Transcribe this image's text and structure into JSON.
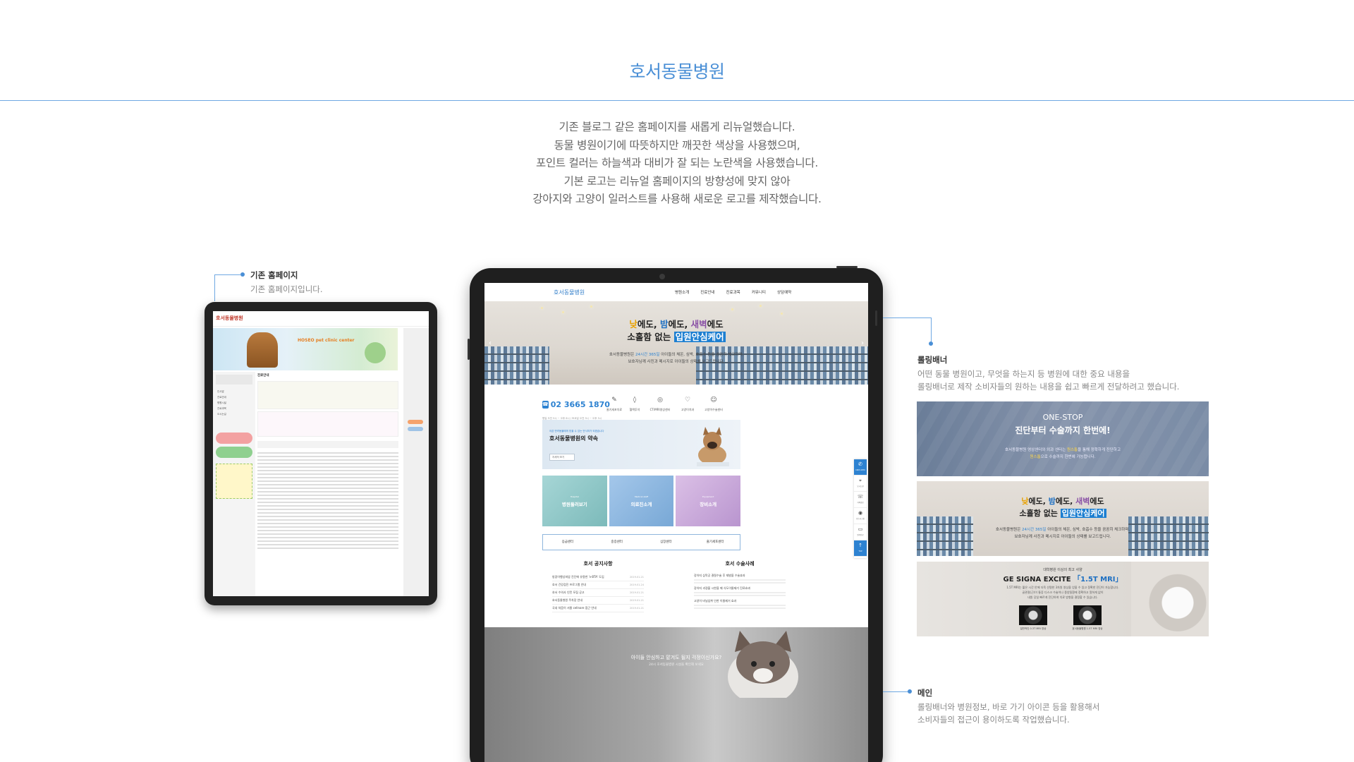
{
  "page": {
    "title": "호서동물병원",
    "intro": [
      "기존 블로그 같은 홈페이지를 새롭게 리뉴얼했습니다.",
      "동물 병원이기에 따뜻하지만 깨끗한 색상을 사용했으며,",
      "포인트 컬러는 하늘색과 대비가 잘 되는 노란색을 사용했습니다.",
      "기본 로고는 리뉴얼 홈페이지의 방향성에 맞지 않아",
      "강아지와 고양이 일러스트를 사용해 새로운 로고를 제작했습니다."
    ]
  },
  "captions": {
    "old": {
      "title": "기존 홈페이지",
      "desc": "기존 홈페이지입니다."
    },
    "rolling": {
      "title": "롤링배너",
      "desc": [
        "어떤 동물 병원이고, 무엇을 하는지 등 병원에 대한 중요 내용을",
        "롤링배너로 제작 소비자들의 원하는 내용을 쉽고 빠르게 전달하려고 했습니다."
      ]
    },
    "main": {
      "title": "메인",
      "desc": [
        "롤링배너와 병원정보, 바로 가기 아이콘 등을 활용해서",
        "소비자들의 접근이 용이하도록 작업했습니다."
      ]
    }
  },
  "old_site": {
    "logo": "호서동물병원",
    "banner_title": "HOSEO pet clinic center",
    "section_title": "진료안내",
    "menu": [
      "인사말",
      "진료안내",
      "병원시설",
      "진료과목",
      "오시는길"
    ]
  },
  "main_site": {
    "logo": "호서동물병원",
    "menu": [
      "병원소개",
      "진료안내",
      "진료과목",
      "커뮤니티",
      "상담예약"
    ],
    "hero": {
      "line1_parts": [
        "낮",
        "에도, ",
        "밤",
        "에도, ",
        "새벽",
        "에도"
      ],
      "line2_pre": "소홀함 없는 ",
      "line2_box": "입원안심케어",
      "sub1_pre": "호서동물병원은 ",
      "sub1_hl": "24시간 365일",
      "sub1_post": " 아이들의 체온, 심박, 호흡수 등을 꼼꼼히 체크하며,",
      "sub2": "보호자님께 사진과 메시지로 아이들의 상태를 보고드립니다."
    },
    "phone": "02 3665 1870",
    "phone_sub": "평일 오전 9시 ~ 오후 8시 / 토요일 오전 9시 ~ 오후 5시",
    "quick": [
      {
        "icon": "syringe-icon",
        "glyph": "✎",
        "label": "줄기세포치료"
      },
      {
        "icon": "drop-icon",
        "glyph": "◊",
        "label": "혈액투석"
      },
      {
        "icon": "ct-icon",
        "glyph": "◎",
        "label": "CT/MRI영상센터"
      },
      {
        "icon": "tooth-icon",
        "glyph": "♡",
        "label": "고양이치과"
      },
      {
        "icon": "cat-icon",
        "glyph": "☺",
        "label": "고양이수술센터"
      }
    ],
    "promise": {
      "small": "아픈 반려동물에게 믿을 수 있는 안식처가 되겠습니다",
      "title": "호서동물병원의 약속",
      "button": "자세히 보기"
    },
    "cards": [
      {
        "small": "Hospital",
        "label": "병원둘러보기",
        "color": "#8fcfcf"
      },
      {
        "small": "Medical staff",
        "label": "의료진소개",
        "color": "#8cb7e0"
      },
      {
        "small": "Equipment",
        "label": "장비소개",
        "color": "#c9a8d8"
      }
    ],
    "centers": [
      "응급센터",
      "중증센터",
      "심장센터",
      "줄기세포센터"
    ],
    "notice": {
      "title": "호서 공지사항",
      "rows": [
        {
          "t": "방광이행상피암 진단에 유용한 'v-BTA' 도입",
          "d": "2019.01.21"
        },
        {
          "t": "호서 건강검진 프로그램 안내",
          "d": "2019.01.24"
        },
        {
          "t": "호서 수의사 인턴 모집 공고",
          "d": "2019.01.21"
        },
        {
          "t": "호서동물병원 주차장 안내",
          "d": "2019.01.21"
        },
        {
          "t": "국내 처음이 서울 cellnare 접근 안내",
          "d": "2019.01.21"
        }
      ]
    },
    "cases": {
      "title": "호서 수술사례",
      "rows": [
        "강아지 심막공 결절수술 후 재발을 수술효과",
        "강아지 괴경불 시한을 때 식도이물제거 진료효과",
        "고양이 비닐섭취 인한 이물제거 효과"
      ]
    },
    "cat_banner": {
      "line1": "아이들 안심하고 맡겨도 될지 걱정이신가요?",
      "line2": "24시 호서동물병원 시설을 확인해 보세요"
    },
    "floating": [
      {
        "icon": "phone-icon",
        "glyph": "✆",
        "label": "1663-1870"
      },
      {
        "icon": "map-pin-icon",
        "glyph": "⌖",
        "label": "오시는길"
      },
      {
        "icon": "chat-icon",
        "glyph": "☏",
        "label": "카톡상담"
      },
      {
        "icon": "instagram-icon",
        "glyph": "◉",
        "label": "인스타그램"
      },
      {
        "icon": "monitor-icon",
        "glyph": "▭",
        "label": "원격진료"
      },
      {
        "icon": "top-icon",
        "glyph": "↑",
        "label": "TOP"
      }
    ]
  },
  "banners": {
    "one_stop": {
      "title": "ONE-STOP",
      "sub": "진단부터 수술까지 한번에!",
      "desc1": "호서동물병원 영상센터와 외과 센터는 ",
      "desc1_hl": "원스톱",
      "desc1_post": "을 통해 정확하게 진단하고",
      "desc2_hl": "원스톱",
      "desc2_post": "으로 수술까지 한번에 가능합니다."
    },
    "care": {
      "line1_parts": [
        "낮",
        "에도, ",
        "밤",
        "에도, ",
        "새벽",
        "에도"
      ],
      "line2_pre": "소홀함 없는 ",
      "line2_box": "입원안심케어",
      "sub1_pre": "호서동물병원은 ",
      "sub1_hl": "24시간 365일",
      "sub1_post": " 아이들의 체온, 심박, 호흡수 등을 꼼꼼히 체크하며,",
      "sub2": "보호자님께 사진과 메시지로 아이들의 상태를 보고드립니다."
    },
    "mri": {
      "small": "대학병원 이상의 최고 사양",
      "title_pre": "GE SIGNA EXCITE ",
      "title_hl": "「1.5T MRI」",
      "desc1": "1.5T MRI는 짧은 시간 안에 더욱 선명한 3차원 영상을 얻을 수 있고 정확한 진단이 가능합니다.",
      "desc2": "골관절(근)이 통증 디스크 수술이나 종양질환에 정확하고 알하게 없이",
      "desc3": "내원 당일 빠르게 진단하여 치료 방향을 결정할 수 있습니다.",
      "img1": "일반적인 0.3T MRI 영상",
      "img2": "호서동물병원 1.5T MRI 영상"
    }
  }
}
